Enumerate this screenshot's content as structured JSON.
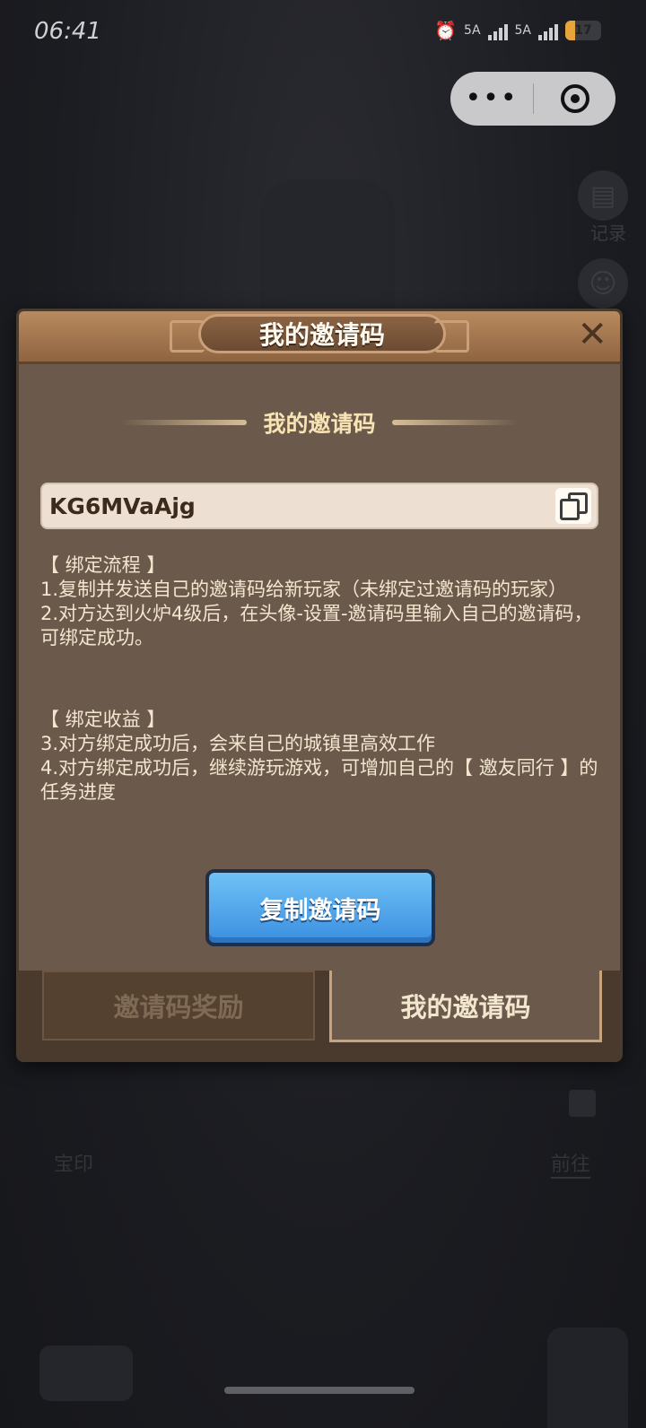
{
  "status_bar": {
    "time": "06:41",
    "signal_1": "5A",
    "signal_2": "5A",
    "battery": "17"
  },
  "capsule": {
    "more_icon": "more-dots-icon",
    "close_icon": "target-close-icon"
  },
  "background": {
    "side_label": "记录",
    "seal_label": "宝印",
    "goto_label": "前往"
  },
  "dialog": {
    "title": "我的邀请码",
    "section_title": "我的邀请码",
    "invite_code": "KG6MVaAjg",
    "rules": {
      "heading_1": "【 绑定流程 】",
      "line_1": "1.复制并发送自己的邀请码给新玩家（未绑定过邀请码的玩家）",
      "line_2": "2.对方达到火炉4级后，在头像-设置-邀请码里输入自己的邀请码，可绑定成功。",
      "heading_2": "【 绑定收益 】",
      "line_3": "3.对方绑定成功后，会来自己的城镇里高效工作",
      "line_4": "4.对方绑定成功后，继续游玩游戏，可增加自己的【 邀友同行 】的任务进度"
    },
    "copy_button": "复制邀请码",
    "tabs": [
      {
        "label": "邀请码奖励",
        "active": false
      },
      {
        "label": "我的邀请码",
        "active": true
      }
    ]
  },
  "colors": {
    "dialog_body": "#6b5a4b",
    "header": "#a67a52",
    "button_blue": "#4fa6ea",
    "text_cream": "#f2e6cf"
  }
}
